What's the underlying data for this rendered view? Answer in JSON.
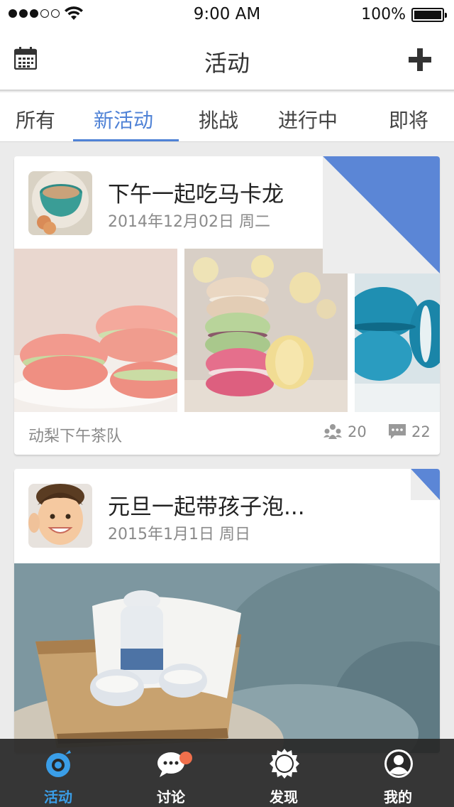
{
  "status": {
    "time": "9:00 AM",
    "battery": "100%"
  },
  "nav": {
    "title": "活动"
  },
  "tabs": [
    {
      "label": "所有",
      "active": false
    },
    {
      "label": "新活动",
      "active": true
    },
    {
      "label": "挑战",
      "active": false
    },
    {
      "label": "进行中",
      "active": false
    },
    {
      "label": "即将",
      "active": false
    }
  ],
  "cards": [
    {
      "title": "下午一起吃马卡龙",
      "date": "2014年12月02日  周二",
      "group": "动梨下午茶队",
      "members": "20",
      "comments": "22"
    },
    {
      "title": "元旦一起带孩子泡...",
      "date": "2015年1月1日  周日"
    }
  ],
  "tabbar": [
    {
      "label": "活动",
      "icon": "activity-icon",
      "active": true
    },
    {
      "label": "讨论",
      "icon": "chat-icon",
      "active": false
    },
    {
      "label": "发现",
      "icon": "discover-icon",
      "active": false
    },
    {
      "label": "我的",
      "icon": "profile-icon",
      "active": false
    }
  ],
  "colors": {
    "accent": "#4f82d6",
    "badge": "#f0704c",
    "tabbar": "#282828"
  }
}
